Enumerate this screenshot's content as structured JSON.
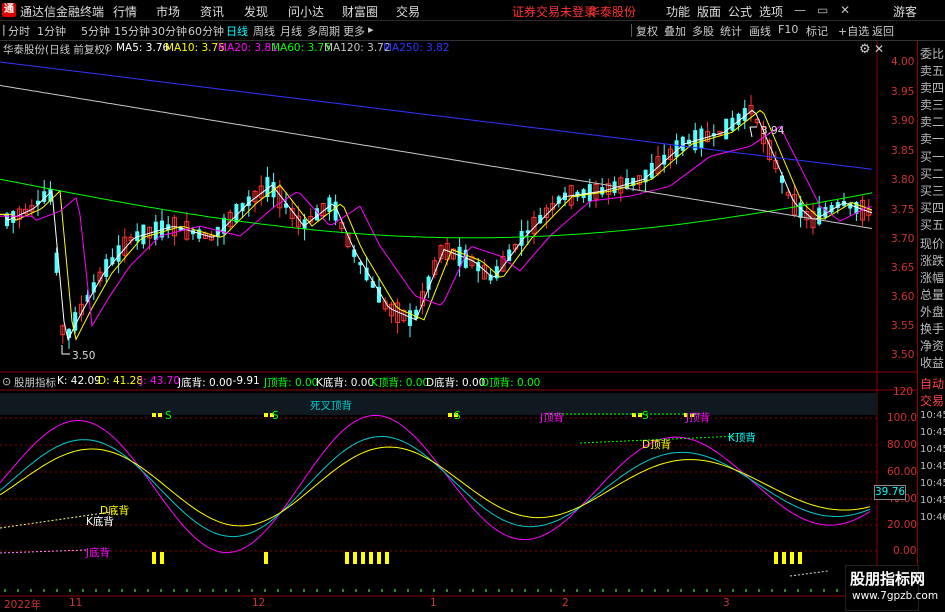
{
  "app": {
    "title": "通达信金融终端",
    "menu": [
      "行情",
      "市场",
      "资讯",
      "发现",
      "问小达",
      "财富圈",
      "交易"
    ],
    "notice": "证券交易未登录",
    "stock_name": "华泰股份",
    "right_menu": [
      "功能",
      "版面",
      "公式",
      "选项"
    ],
    "user": "游客"
  },
  "toolbar": {
    "periods": [
      "分时",
      "1分钟",
      "5分钟",
      "15分钟",
      "30分钟",
      "60分钟",
      "日线",
      "周线",
      "月线",
      "多周期",
      "更多"
    ],
    "active_period": "日线",
    "right": [
      "复权",
      "叠加",
      "多股",
      "统计",
      "画线",
      "F10",
      "标记",
      "+自选",
      "返回"
    ]
  },
  "main_chart": {
    "title": "华泰股份(日线 前复权)",
    "ma": [
      {
        "label": "MA5: 3.76",
        "color": "#ffffff"
      },
      {
        "label": "MA10: 3.75",
        "color": "#ffff00"
      },
      {
        "label": "MA20: 3.81",
        "color": "#ff00ff"
      },
      {
        "label": "MA60: 3.75",
        "color": "#00ff00"
      },
      {
        "label": "MA120: 3.72",
        "color": "#c8c8c8"
      },
      {
        "label": "MA250: 3.82",
        "color": "#3333ff"
      }
    ],
    "y_ticks": [
      "4.00",
      "3.95",
      "3.90",
      "3.85",
      "3.80",
      "3.75",
      "3.70",
      "3.65",
      "3.60",
      "3.55",
      "3.50"
    ],
    "high_label": "3.94",
    "low_label": "3.50"
  },
  "indicator": {
    "title": "股朋指标",
    "values": [
      {
        "label": "K: 42.09",
        "color": "#ffffff"
      },
      {
        "label": "D: 41.28",
        "color": "#ffff00"
      },
      {
        "label": "J: 43.70",
        "color": "#ff00ff"
      },
      {
        "label": "J底背: 0.00",
        "color": "#ffffff"
      },
      {
        "label": ":-9.91",
        "color": "#ffffff"
      },
      {
        "label": "J顶背: 0.00",
        "color": "#00ff00"
      },
      {
        "label": "K底背: 0.00",
        "color": "#ffffff"
      },
      {
        "label": "K顶背: 0.00",
        "color": "#00ff00"
      },
      {
        "label": "D底背: 0.00",
        "color": "#ffffff"
      },
      {
        "label": "D顶背: 0.00",
        "color": "#00ff00"
      }
    ],
    "y_ticks": [
      "120",
      "100.00",
      "80.00",
      "60.00",
      "40.00",
      "20.00",
      "0.00"
    ],
    "current_value": "39.76",
    "annotations": [
      "死叉顶背",
      "J顶背",
      "D顶背",
      "K顶背",
      "D底背",
      "K底背",
      "J底背"
    ],
    "s_mark": "S"
  },
  "time_axis": [
    "2022年",
    "11",
    "12",
    "1",
    "2",
    "3"
  ],
  "sidebar": {
    "items": [
      "委比",
      "卖五",
      "卖四",
      "卖三",
      "卖二",
      "卖一",
      "买一",
      "买二",
      "买三",
      "买四",
      "买五",
      "现价",
      "涨跌",
      "涨幅",
      "总量",
      "外盘",
      "换手",
      "净资",
      "收益",
      "自动",
      "交易",
      "10:45",
      "10:45",
      "10:45",
      "10:45",
      "10:45",
      "10:45",
      "10:46"
    ]
  },
  "watermark": {
    "line1": "股朋指标网",
    "line2": "www.7gpzb.com"
  }
}
